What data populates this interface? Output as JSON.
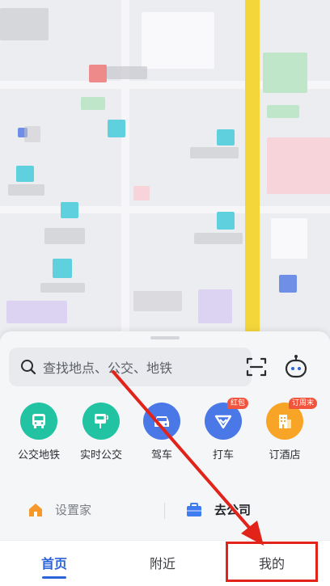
{
  "search": {
    "placeholder": "查找地点、公交、地铁"
  },
  "icons": {
    "search": "search-icon",
    "scan": "scan-icon",
    "assistant": "assistant-robot-icon"
  },
  "quick_actions": [
    {
      "label": "公交地铁",
      "icon": "bus-icon",
      "color": "#22c3a2",
      "badge": ""
    },
    {
      "label": "实时公交",
      "icon": "bus-stop-icon",
      "color": "#22c3a2",
      "badge": ""
    },
    {
      "label": "驾车",
      "icon": "car-icon",
      "color": "#4a78e6",
      "badge": ""
    },
    {
      "label": "打车",
      "icon": "taxi-icon",
      "color": "#4a78e6",
      "badge": "红包"
    },
    {
      "label": "订酒店",
      "icon": "hotel-icon",
      "color": "#f7a427",
      "badge": "订周末"
    }
  ],
  "places": {
    "home": {
      "label": "设置家",
      "icon": "home-icon",
      "color": "#f59a2a"
    },
    "work": {
      "label": "去公司",
      "icon": "briefcase-icon",
      "color": "#3f7cf2"
    }
  },
  "tabs": [
    {
      "label": "首页",
      "active": true
    },
    {
      "label": "附近",
      "active": false
    },
    {
      "label": "我的",
      "active": false
    }
  ],
  "colors": {
    "accent": "#2b63d9",
    "annotation": "#e2231a",
    "road": "#f4d63b"
  }
}
